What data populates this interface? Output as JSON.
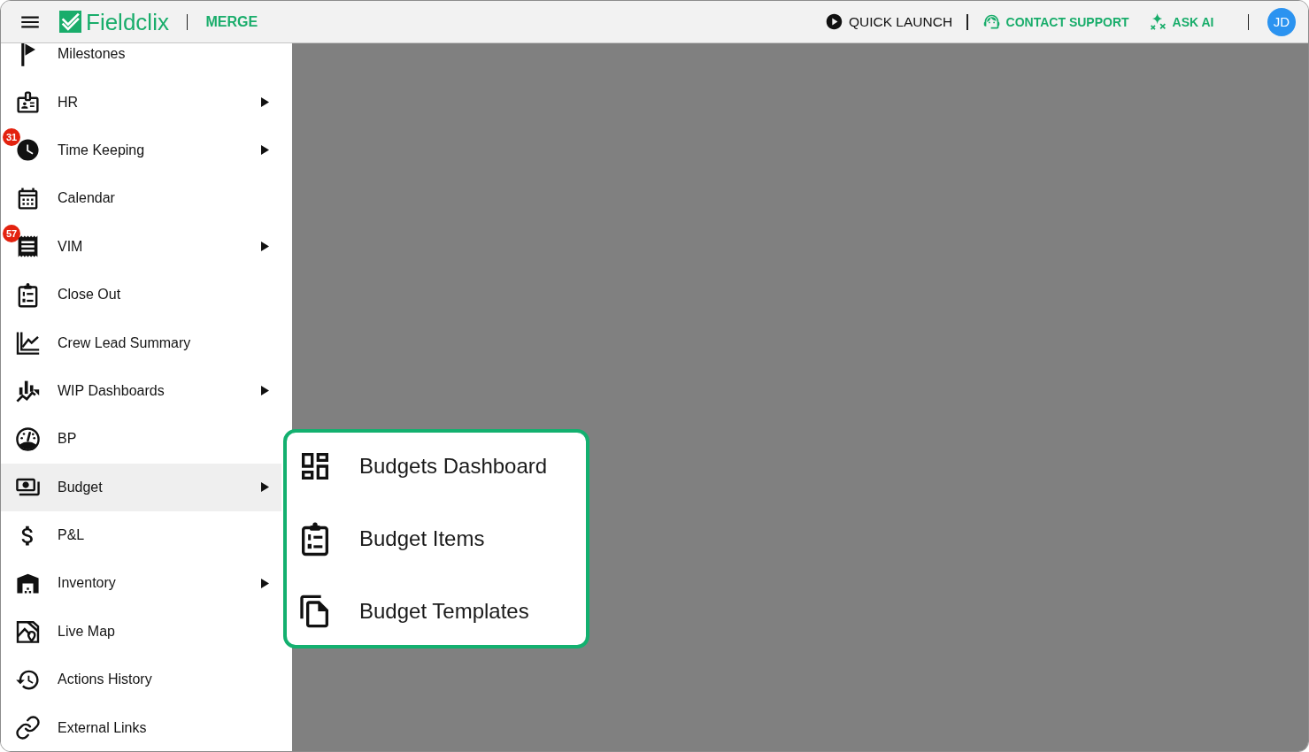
{
  "header": {
    "app_name": "Fieldclix",
    "module": "MERGE",
    "actions": [
      {
        "label": "QUICK LAUNCH",
        "kind": "plain",
        "divider_after": true
      },
      {
        "label": "CONTACT SUPPORT",
        "kind": "accent",
        "divider_after": false
      },
      {
        "label": "ASK AI",
        "kind": "accent",
        "divider_after": true
      }
    ],
    "avatar": "JD"
  },
  "sidebar": {
    "items": [
      {
        "label": "Milestones",
        "has_submenu": false,
        "selected": false
      },
      {
        "label": "HR",
        "has_submenu": true,
        "selected": false
      },
      {
        "label": "Time Keeping",
        "badge": "31",
        "has_submenu": true,
        "selected": false
      },
      {
        "label": "Calendar",
        "has_submenu": false,
        "selected": false
      },
      {
        "label": "VIM",
        "badge": "57",
        "has_submenu": true,
        "selected": false
      },
      {
        "label": "Close Out",
        "has_submenu": false,
        "selected": false
      },
      {
        "label": "Crew Lead Summary",
        "has_submenu": false,
        "selected": false
      },
      {
        "label": "WIP Dashboards",
        "has_submenu": true,
        "selected": false
      },
      {
        "label": "BP",
        "has_submenu": false,
        "selected": false
      },
      {
        "label": "Budget",
        "has_submenu": true,
        "selected": true
      },
      {
        "label": "P&L",
        "has_submenu": false,
        "selected": false
      },
      {
        "label": "Inventory",
        "has_submenu": true,
        "selected": false
      },
      {
        "label": "Live Map",
        "has_submenu": false,
        "selected": false
      },
      {
        "label": "Actions History",
        "has_submenu": false,
        "selected": false
      },
      {
        "label": "External Links",
        "has_submenu": false,
        "selected": false
      }
    ]
  },
  "submenu": {
    "items": [
      {
        "label": "Budgets Dashboard"
      },
      {
        "label": "Budget Items"
      },
      {
        "label": "Budget Templates"
      }
    ]
  }
}
